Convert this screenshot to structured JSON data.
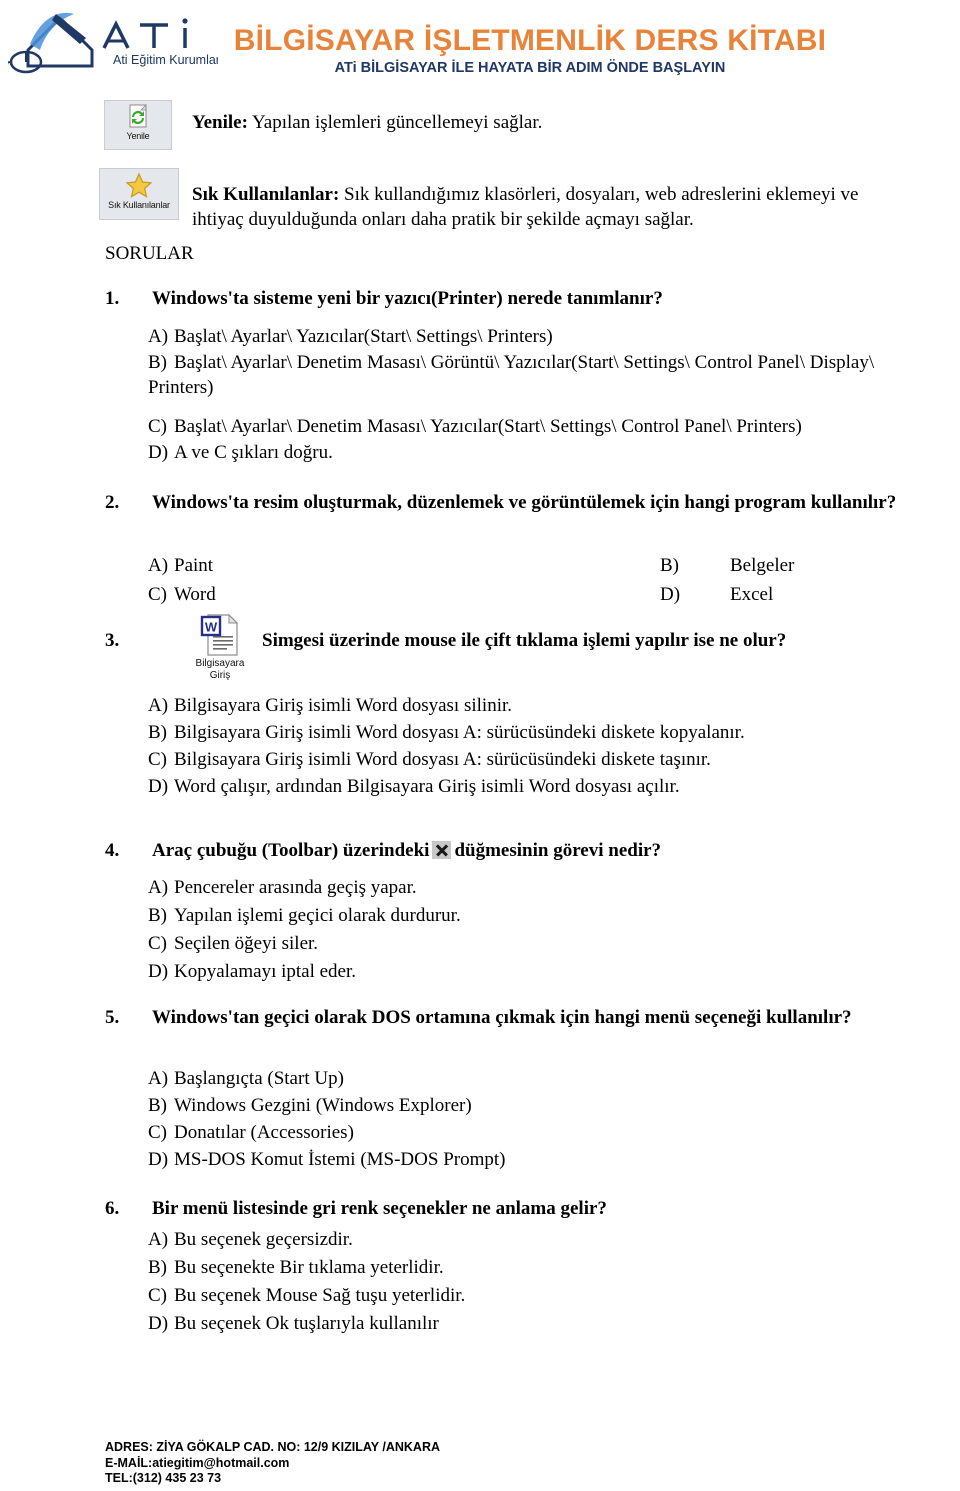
{
  "header": {
    "logo_alt": "ATI Eğitim Kurumları",
    "logo_letters": "A T İ",
    "logo_caption": "Ati Eğitim Kurumları",
    "title": "BİLGİSAYAR İŞLETMENLİK DERS KİTABI",
    "subtitle": "ATi BİLGİSAYAR İLE HAYATA BİR ADIM ÖNDE BAŞLAYIN",
    "title_color": "#E8833A",
    "subtitle_color": "#1F3864"
  },
  "toolbar_items": [
    {
      "icon_caption": "Yenile",
      "term": "Yenile:",
      "description": "Yapılan işlemleri güncellemeyi sağlar."
    },
    {
      "icon_caption": "Sık Kullanılanlar",
      "term": "Sık Kullanılanlar:",
      "description": "Sık kullandığımız klasörleri, dosyaları, web adreslerini eklemeyi ve ihtiyaç duyulduğunda onları daha pratik bir şekilde açmayı sağlar."
    }
  ],
  "section_heading": "SORULAR",
  "questions": [
    {
      "number": "1.",
      "text": "Windows'ta sisteme yeni bir yazıcı(Printer) nerede tanımlanır?",
      "options": [
        {
          "letter": "A)",
          "text": "Başlat\\ Ayarlar\\ Yazıcılar(Start\\ Settings\\ Printers)"
        },
        {
          "letter": "B)",
          "text": "Başlat\\ Ayarlar\\ Denetim Masası\\ Görüntü\\ Yazıcılar(Start\\ Settings\\ Control Panel\\ Display\\ Printers)"
        },
        {
          "letter": "C)",
          "text": "Başlat\\ Ayarlar\\ Denetim Masası\\ Yazıcılar(Start\\ Settings\\ Control Panel\\ Printers)"
        },
        {
          "letter": "D)",
          "text": "A ve C şıkları doğru."
        }
      ]
    },
    {
      "number": "2.",
      "text": "Windows'ta resim oluşturmak, düzenlemek ve görüntülemek için hangi program kullanılır?",
      "options": [
        {
          "letter": "A)",
          "text": "Paint"
        },
        {
          "letter": "B)",
          "text": "Belgeler"
        },
        {
          "letter": "C)",
          "text": "Word"
        },
        {
          "letter": "D)",
          "text": "Excel"
        }
      ]
    },
    {
      "number": "3.",
      "icon_caption_line1": "Bilgisayara",
      "icon_caption_line2": "Giriş",
      "text": "Simgesi üzerinde mouse ile çift tıklama işlemi yapılır ise ne olur?",
      "options": [
        {
          "letter": "A)",
          "text": "Bilgisayara Giriş isimli Word dosyası silinir."
        },
        {
          "letter": "B)",
          "text": "Bilgisayara Giriş isimli Word dosyası A: sürücüsündeki diskete kopyalanır."
        },
        {
          "letter": "C)",
          "text": "Bilgisayara Giriş isimli Word dosyası A: sürücüsündeki diskete taşınır."
        },
        {
          "letter": "D)",
          "text": "Word çalışır, ardından Bilgisayara Giriş isimli Word dosyası açılır."
        }
      ]
    },
    {
      "number": "4.",
      "text_before_icon": "Araç çubuğu (Toolbar) üzerindeki",
      "text_after_icon": "düğmesinin görevi nedir?",
      "options": [
        {
          "letter": "A)",
          "text": "Pencereler arasında geçiş yapar."
        },
        {
          "letter": "B)",
          "text": "Yapılan işlemi geçici olarak durdurur."
        },
        {
          "letter": "C)",
          "text": "Seçilen öğeyi siler."
        },
        {
          "letter": "D)",
          "text": "Kopyalamayı iptal eder."
        }
      ]
    },
    {
      "number": "5.",
      "text": "Windows'tan geçici olarak DOS ortamına çıkmak için hangi menü seçeneği kullanılır?",
      "options": [
        {
          "letter": "A)",
          "text": "Başlangıçta (Start Up)"
        },
        {
          "letter": "B)",
          "text": "Windows Gezgini (Windows Explorer)"
        },
        {
          "letter": "C)",
          "text": "Donatılar (Accessories)"
        },
        {
          "letter": "D)",
          "text": "MS-DOS Komut İstemi (MS-DOS Prompt)"
        }
      ]
    },
    {
      "number": "6.",
      "text": "Bir menü listesinde gri renk seçenekler ne anlama gelir?",
      "options": [
        {
          "letter": "A)",
          "text": "Bu seçenek geçersizdir."
        },
        {
          "letter": "B)",
          "text": "Bu seçenekte Bir tıklama yeterlidir."
        },
        {
          "letter": "C)",
          "text": "Bu seçenek Mouse Sağ tuşu yeterlidir."
        },
        {
          "letter": "D)",
          "text": "Bu seçenek Ok tuşlarıyla kullanılır"
        }
      ]
    }
  ],
  "footer": {
    "address": "ADRES: ZİYA GÖKALP CAD. NO: 12/9 KIZILAY /ANKARA",
    "email": "E-MAİL:atiegitim@hotmail.com",
    "phone": "TEL:(312) 435 23 73"
  }
}
